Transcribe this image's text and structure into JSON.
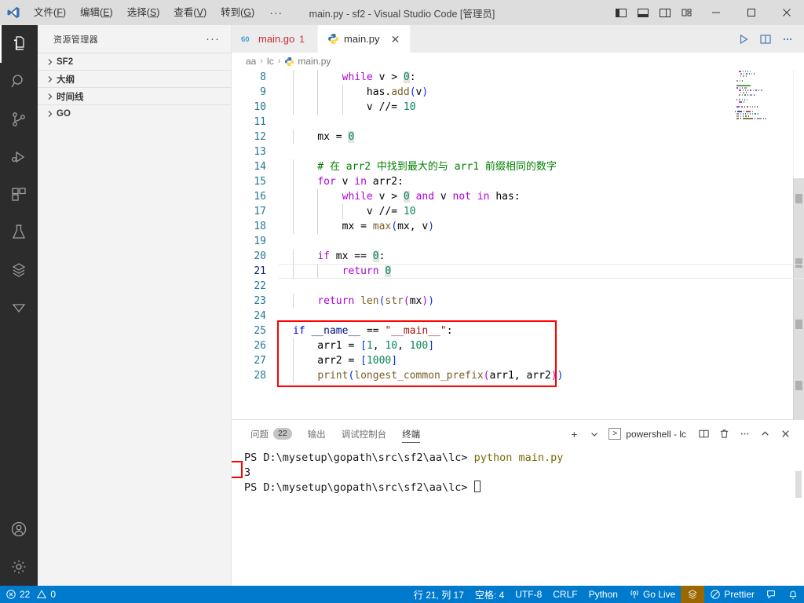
{
  "titlebar": {
    "logo_icon": "vscode-logo-icon",
    "menus": [
      {
        "label": "文件",
        "accel": "F"
      },
      {
        "label": "编辑",
        "accel": "E"
      },
      {
        "label": "选择",
        "accel": "S"
      },
      {
        "label": "查看",
        "accel": "V"
      },
      {
        "label": "转到",
        "accel": "G"
      }
    ],
    "more_label": "···",
    "window_title": "main.py - sf2 - Visual Studio Code [管理员]",
    "layout_buttons": [
      {
        "name": "toggle-primary-sidebar-icon"
      },
      {
        "name": "toggle-panel-icon"
      },
      {
        "name": "toggle-secondary-sidebar-icon"
      },
      {
        "name": "customize-layout-icon"
      }
    ],
    "window_controls": [
      {
        "name": "minimize-button",
        "glyph": "—"
      },
      {
        "name": "maximize-button",
        "glyph": "☐"
      },
      {
        "name": "close-button",
        "glyph": "✕"
      }
    ]
  },
  "activitybar": {
    "items": [
      {
        "name": "explorer",
        "icon": "files-icon",
        "active": true
      },
      {
        "name": "search",
        "icon": "search-icon",
        "active": false
      },
      {
        "name": "source-control",
        "icon": "source-control-icon",
        "active": false
      },
      {
        "name": "run-and-debug",
        "icon": "run-debug-icon",
        "active": false
      },
      {
        "name": "extensions",
        "icon": "extensions-icon",
        "active": false
      },
      {
        "name": "testing",
        "icon": "beaker-icon",
        "active": false
      },
      {
        "name": "go-tools",
        "icon": "gopher-icon",
        "active": false
      },
      {
        "name": "filter",
        "icon": "triangle-down-icon",
        "active": false
      }
    ],
    "bottom": [
      {
        "name": "accounts",
        "icon": "account-icon"
      },
      {
        "name": "manage-settings",
        "icon": "gear-icon"
      }
    ]
  },
  "sidebar": {
    "title": "资源管理器",
    "more_label": "···",
    "sections": [
      {
        "label": "SF2",
        "expanded": false
      },
      {
        "label": "大纲",
        "expanded": false
      },
      {
        "label": "时间线",
        "expanded": false
      },
      {
        "label": "GO",
        "expanded": false
      }
    ]
  },
  "editor": {
    "tabs": [
      {
        "label": "main.go",
        "icon": "go-file-icon",
        "badge": "1",
        "active": false,
        "close_glyph": ""
      },
      {
        "label": "main.py",
        "icon": "python-file-icon",
        "badge": "",
        "active": true,
        "close_glyph": "✕"
      }
    ],
    "actions": [
      {
        "name": "run-python-file-button",
        "icon": "play-icon"
      },
      {
        "name": "split-editor-right-button",
        "icon": "split-editor-icon"
      },
      {
        "name": "more-editor-actions-button",
        "icon": "ellipsis-icon"
      }
    ],
    "breadcrumbs": [
      {
        "label": "aa",
        "icon": ""
      },
      {
        "label": "lc",
        "icon": ""
      },
      {
        "label": "main.py",
        "icon": "python-file-icon"
      }
    ],
    "first_visible_line": 8,
    "lines": [
      {
        "n": 8,
        "indent_guides": 2,
        "tokens": [
          {
            "t": "        ",
            "c": "plain"
          },
          {
            "t": "while",
            "c": "kwc"
          },
          {
            "t": " v ",
            "c": "plain"
          },
          {
            "t": ">",
            "c": "plain"
          },
          {
            "t": " ",
            "c": "plain"
          },
          {
            "t": "0",
            "c": "num occ"
          },
          {
            "t": ":",
            "c": "plain"
          }
        ]
      },
      {
        "n": 9,
        "indent_guides": 3,
        "tokens": [
          {
            "t": "            has",
            "c": "plain"
          },
          {
            "t": ".",
            "c": "plain"
          },
          {
            "t": "add",
            "c": "fn"
          },
          {
            "t": "(",
            "c": "bk1"
          },
          {
            "t": "v",
            "c": "plain"
          },
          {
            "t": ")",
            "c": "bk1"
          }
        ]
      },
      {
        "n": 10,
        "indent_guides": 3,
        "tokens": [
          {
            "t": "            v ",
            "c": "plain"
          },
          {
            "t": "//=",
            "c": "plain"
          },
          {
            "t": " ",
            "c": "plain"
          },
          {
            "t": "10",
            "c": "num"
          }
        ]
      },
      {
        "n": 11,
        "indent_guides": 0,
        "tokens": []
      },
      {
        "n": 12,
        "indent_guides": 1,
        "tokens": [
          {
            "t": "    mx ",
            "c": "plain"
          },
          {
            "t": "=",
            "c": "plain"
          },
          {
            "t": " ",
            "c": "plain"
          },
          {
            "t": "0",
            "c": "num occ"
          }
        ]
      },
      {
        "n": 13,
        "indent_guides": 0,
        "tokens": []
      },
      {
        "n": 14,
        "indent_guides": 1,
        "tokens": [
          {
            "t": "    # 在 arr2 中找到最大的与 arr1 前缀相同的数字",
            "c": "cmt"
          }
        ]
      },
      {
        "n": 15,
        "indent_guides": 1,
        "tokens": [
          {
            "t": "    ",
            "c": "plain"
          },
          {
            "t": "for",
            "c": "kwc"
          },
          {
            "t": " v ",
            "c": "plain"
          },
          {
            "t": "in",
            "c": "kwc"
          },
          {
            "t": " arr2:",
            "c": "plain"
          }
        ]
      },
      {
        "n": 16,
        "indent_guides": 2,
        "tokens": [
          {
            "t": "        ",
            "c": "plain"
          },
          {
            "t": "while",
            "c": "kwc"
          },
          {
            "t": " v ",
            "c": "plain"
          },
          {
            "t": ">",
            "c": "plain"
          },
          {
            "t": " ",
            "c": "plain"
          },
          {
            "t": "0",
            "c": "num occ"
          },
          {
            "t": " ",
            "c": "plain"
          },
          {
            "t": "and",
            "c": "kwc"
          },
          {
            "t": " v ",
            "c": "plain"
          },
          {
            "t": "not",
            "c": "kwc"
          },
          {
            "t": " ",
            "c": "plain"
          },
          {
            "t": "in",
            "c": "kwc"
          },
          {
            "t": " has:",
            "c": "plain"
          }
        ]
      },
      {
        "n": 17,
        "indent_guides": 3,
        "tokens": [
          {
            "t": "            v ",
            "c": "plain"
          },
          {
            "t": "//=",
            "c": "plain"
          },
          {
            "t": " ",
            "c": "plain"
          },
          {
            "t": "10",
            "c": "num"
          }
        ]
      },
      {
        "n": 18,
        "indent_guides": 2,
        "tokens": [
          {
            "t": "        mx ",
            "c": "plain"
          },
          {
            "t": "=",
            "c": "plain"
          },
          {
            "t": " ",
            "c": "plain"
          },
          {
            "t": "max",
            "c": "fn"
          },
          {
            "t": "(",
            "c": "bk1"
          },
          {
            "t": "mx, v",
            "c": "plain"
          },
          {
            "t": ")",
            "c": "bk1"
          }
        ]
      },
      {
        "n": 19,
        "indent_guides": 0,
        "tokens": []
      },
      {
        "n": 20,
        "indent_guides": 1,
        "tokens": [
          {
            "t": "    ",
            "c": "plain"
          },
          {
            "t": "if",
            "c": "kwc"
          },
          {
            "t": " mx ",
            "c": "plain"
          },
          {
            "t": "==",
            "c": "plain"
          },
          {
            "t": " ",
            "c": "plain"
          },
          {
            "t": "0",
            "c": "num occ"
          },
          {
            "t": ":",
            "c": "plain"
          }
        ]
      },
      {
        "n": 21,
        "indent_guides": 2,
        "current": true,
        "tokens": [
          {
            "t": "        ",
            "c": "plain"
          },
          {
            "t": "return",
            "c": "kwc"
          },
          {
            "t": " ",
            "c": "plain"
          },
          {
            "t": "0",
            "c": "num occ"
          }
        ]
      },
      {
        "n": 22,
        "indent_guides": 0,
        "tokens": []
      },
      {
        "n": 23,
        "indent_guides": 1,
        "tokens": [
          {
            "t": "    ",
            "c": "plain"
          },
          {
            "t": "return",
            "c": "kwc"
          },
          {
            "t": " ",
            "c": "plain"
          },
          {
            "t": "len",
            "c": "fn"
          },
          {
            "t": "(",
            "c": "bk1"
          },
          {
            "t": "str",
            "c": "fn"
          },
          {
            "t": "(",
            "c": "kwc"
          },
          {
            "t": "mx",
            "c": "plain"
          },
          {
            "t": ")",
            "c": "kwc"
          },
          {
            "t": ")",
            "c": "bk1"
          }
        ]
      },
      {
        "n": 24,
        "indent_guides": 0,
        "tokens": []
      },
      {
        "n": 25,
        "indent_guides": 0,
        "tokens": [
          {
            "t": "if",
            "c": "kw"
          },
          {
            "t": " __name__ ",
            "c": "var"
          },
          {
            "t": "==",
            "c": "plain"
          },
          {
            "t": " ",
            "c": "plain"
          },
          {
            "t": "\"__main__\"",
            "c": "str"
          },
          {
            "t": ":",
            "c": "plain"
          }
        ]
      },
      {
        "n": 26,
        "indent_guides": 1,
        "tokens": [
          {
            "t": "    arr1 ",
            "c": "plain"
          },
          {
            "t": "=",
            "c": "plain"
          },
          {
            "t": " ",
            "c": "plain"
          },
          {
            "t": "[",
            "c": "bk1"
          },
          {
            "t": "1",
            "c": "num"
          },
          {
            "t": ", ",
            "c": "plain"
          },
          {
            "t": "10",
            "c": "num"
          },
          {
            "t": ", ",
            "c": "plain"
          },
          {
            "t": "100",
            "c": "num"
          },
          {
            "t": "]",
            "c": "bk1"
          }
        ]
      },
      {
        "n": 27,
        "indent_guides": 1,
        "tokens": [
          {
            "t": "    arr2 ",
            "c": "plain"
          },
          {
            "t": "=",
            "c": "plain"
          },
          {
            "t": " ",
            "c": "plain"
          },
          {
            "t": "[",
            "c": "bk1"
          },
          {
            "t": "1000",
            "c": "num"
          },
          {
            "t": "]",
            "c": "bk1"
          }
        ]
      },
      {
        "n": 28,
        "indent_guides": 1,
        "tokens": [
          {
            "t": "    ",
            "c": "plain"
          },
          {
            "t": "print",
            "c": "fn"
          },
          {
            "t": "(",
            "c": "bk1"
          },
          {
            "t": "longest_common_prefix",
            "c": "fn"
          },
          {
            "t": "(",
            "c": "kwc"
          },
          {
            "t": "arr1, arr2",
            "c": "plain"
          },
          {
            "t": ")",
            "c": "kwc"
          },
          {
            "t": ")",
            "c": "bk1"
          }
        ]
      }
    ]
  },
  "panel": {
    "tabs": [
      {
        "label": "问题",
        "count": "22",
        "active": false
      },
      {
        "label": "输出",
        "count": "",
        "active": false
      },
      {
        "label": "调试控制台",
        "count": "",
        "active": false
      },
      {
        "label": "终端",
        "count": "",
        "active": true
      }
    ],
    "actions": {
      "new_terminal_label": "+",
      "new_terminal_dropdown_icon": "chevron-down-icon",
      "active_terminal": "powershell - lc",
      "split_icon": "split-terminal-icon",
      "kill_icon": "trash-icon",
      "more_icon": "ellipsis-icon",
      "maximize_icon": "chevron-up-icon",
      "close_icon": "close-icon"
    },
    "terminal": {
      "prompt": "PS D:\\mysetup\\gopath\\src\\sf2\\aa\\lc>",
      "command": "python main.py",
      "output": "3",
      "prompt2": "PS D:\\mysetup\\gopath\\src\\sf2\\aa\\lc>"
    }
  },
  "statusbar": {
    "left": [
      {
        "name": "problems",
        "icon": "error-icon",
        "errors": "22",
        "warn_icon": "warning-icon",
        "warnings": "0"
      }
    ],
    "right": [
      {
        "name": "editor-position",
        "label": "行 21, 列 17"
      },
      {
        "name": "indentation",
        "label": "空格: 4"
      },
      {
        "name": "encoding",
        "label": "UTF-8"
      },
      {
        "name": "eol",
        "label": "CRLF"
      },
      {
        "name": "language-mode",
        "label": "Python"
      },
      {
        "name": "go-live",
        "label": "Go Live",
        "icon": "broadcast-icon"
      },
      {
        "name": "gopher-status",
        "label": "",
        "icon": "gopher-icon",
        "highlight": "#9a6700"
      },
      {
        "name": "prettier",
        "label": "Prettier",
        "icon": "prettier-icon"
      },
      {
        "name": "remote-feedback",
        "label": "",
        "icon": "feedback-icon"
      },
      {
        "name": "notifications",
        "label": "",
        "icon": "bell-icon"
      }
    ]
  },
  "colors": {
    "accent": "#007acc",
    "titlebar_bg": "#dddddd",
    "activitybar_bg": "#2c2c2c",
    "sidebar_bg": "#f3f3f3",
    "highlight_box": "#ff0000"
  }
}
